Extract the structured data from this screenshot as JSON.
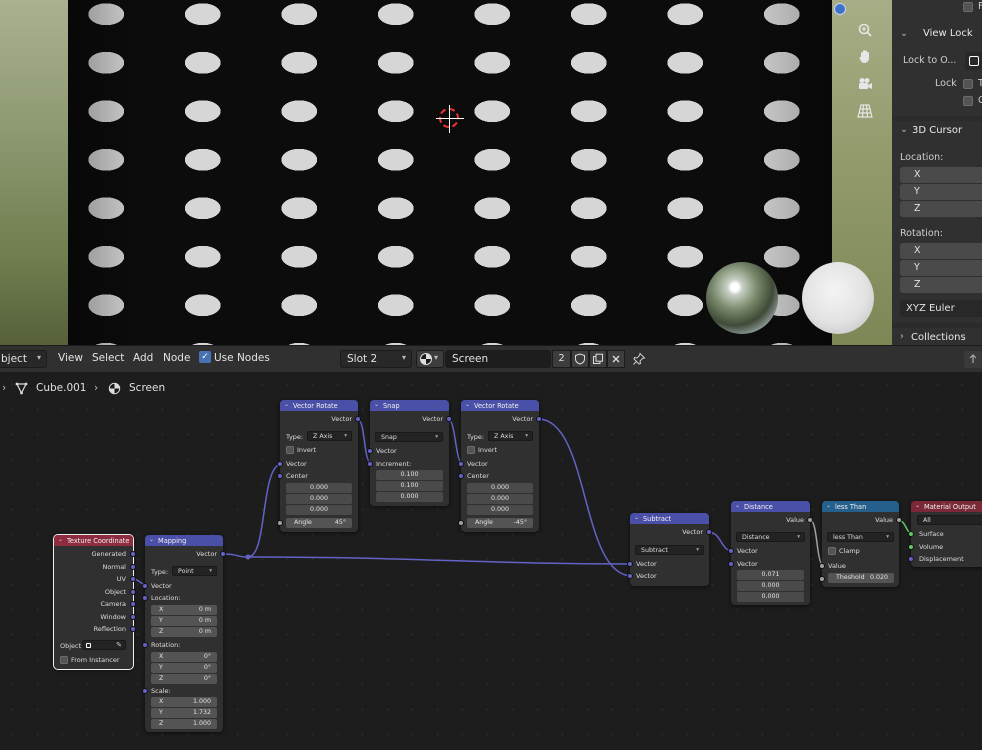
{
  "npanel": {
    "row0_check_label": "F",
    "view_lock_header": "View Lock",
    "lock_to_object_label": "Lock to O...",
    "lock_label": "Lock",
    "lock_row1_letter": "T",
    "lock_row2_letter": "C",
    "cursor_header": "3D Cursor",
    "location_label": "Location:",
    "rotation_label": "Rotation:",
    "axes": [
      "X",
      "Y",
      "Z"
    ],
    "rotation_mode": "XYZ Euler",
    "collections_header": "Collections"
  },
  "header": {
    "mode_label": "bject",
    "menus": [
      "View",
      "Select",
      "Add",
      "Node"
    ],
    "use_nodes_label": "Use Nodes",
    "slot_label": "Slot 2",
    "material_name": "Screen",
    "user_count": "2"
  },
  "breadcrumb": {
    "object": "Cube.001",
    "material": "Screen"
  },
  "nodes": {
    "texcoord": {
      "title": "Texture Coordinate",
      "outputs": [
        "Generated",
        "Normal",
        "UV",
        "Object",
        "Camera",
        "Window",
        "Reflection"
      ],
      "object_label": "Object:",
      "from_instancer": "From Instancer"
    },
    "mapping": {
      "title": "Mapping",
      "output": "Vector",
      "type_label": "Type:",
      "type_value": "Point",
      "vector_in": "Vector",
      "location_label": "Location:",
      "location": [
        "0 m",
        "0 m",
        "0 m"
      ],
      "rotation_label": "Rotation:",
      "rotation": [
        "0°",
        "0°",
        "0°"
      ],
      "scale_label": "Scale:",
      "scale": [
        "1.000",
        "1.732",
        "1.000"
      ]
    },
    "rot1": {
      "title": "Vector Rotate",
      "output": "Vector",
      "type_label": "Type:",
      "type_value": "Z Axis",
      "invert": "Invert",
      "vector_in": "Vector",
      "center_in": "Center",
      "center": [
        "0.000",
        "0.000",
        "0.000"
      ],
      "angle_label": "Angle",
      "angle_value": "45°"
    },
    "snap": {
      "title": "Snap",
      "output": "Vector",
      "op": "Snap",
      "vector_in": "Vector",
      "increment_label": "Increment:",
      "increment": [
        "0.100",
        "0.100",
        "0.000"
      ]
    },
    "rot2": {
      "title": "Vector Rotate",
      "output": "Vector",
      "type_label": "Type:",
      "type_value": "Z Axis",
      "invert": "Invert",
      "vector_in": "Vector",
      "center_in": "Center",
      "center": [
        "0.000",
        "0.000",
        "0.000"
      ],
      "angle_label": "Angle",
      "angle_value": "-45°"
    },
    "subtract": {
      "title": "Subtract",
      "output": "Vector",
      "op": "Subtract",
      "in1": "Vector",
      "in2": "Vector"
    },
    "distance": {
      "title": "Distance",
      "output": "Value",
      "op": "Distance",
      "in1": "Vector",
      "in2": "Vector",
      "values": [
        "0.071",
        "0.000",
        "0.000"
      ]
    },
    "lessthan": {
      "title": "less Than",
      "output": "Value",
      "op": "less Than",
      "clamp": "Clamp",
      "value_in": "Value",
      "threshold_label": "Theshold",
      "threshold_value": "0.020"
    },
    "matout": {
      "title": "Material Output",
      "target": "All",
      "inputs": [
        "Surface",
        "Volume",
        "Displacement"
      ]
    }
  },
  "colors": {
    "vector_header": "#4a4fa8",
    "texture_header": "#8d2d3f",
    "converter_header": "#25608c",
    "output_header": "#7b2938",
    "vector_link": "#6363c7",
    "shader_link": "#63c763",
    "value_link": "#a1a1a1"
  }
}
